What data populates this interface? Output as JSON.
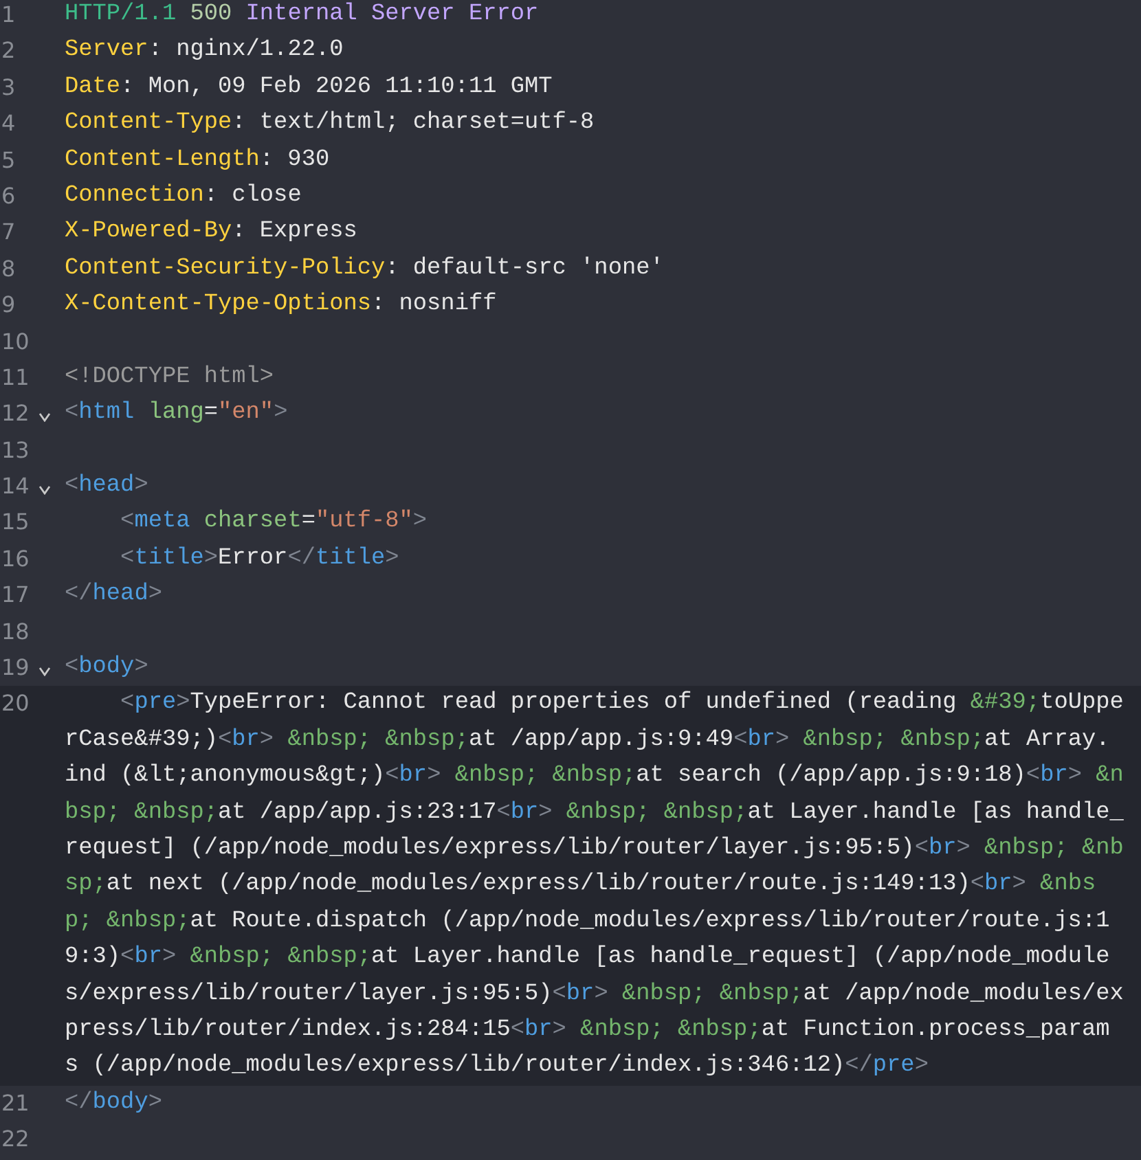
{
  "editor": {
    "lines": [
      {
        "number": "1",
        "rows": [
          {
            "segments": [
              {
                "kind": "proto",
                "text": "HTTP/1.1 "
              },
              {
                "kind": "code",
                "text": "500 "
              },
              {
                "kind": "reason",
                "text": "Internal Server Error"
              }
            ]
          }
        ]
      },
      {
        "number": "2",
        "rows": [
          {
            "segments": [
              {
                "kind": "header",
                "text": "Server"
              },
              {
                "kind": "text",
                "text": ": nginx/1.22.0"
              }
            ]
          }
        ]
      },
      {
        "number": "3",
        "rows": [
          {
            "segments": [
              {
                "kind": "header",
                "text": "Date"
              },
              {
                "kind": "text",
                "text": ": Mon, 09 Feb 2026 11:10:11 GMT"
              }
            ]
          }
        ]
      },
      {
        "number": "4",
        "rows": [
          {
            "segments": [
              {
                "kind": "header",
                "text": "Content-Type"
              },
              {
                "kind": "text",
                "text": ": text/html; charset=utf-8"
              }
            ]
          }
        ]
      },
      {
        "number": "5",
        "rows": [
          {
            "segments": [
              {
                "kind": "header",
                "text": "Content-Length"
              },
              {
                "kind": "text",
                "text": ": 930"
              }
            ]
          }
        ]
      },
      {
        "number": "6",
        "rows": [
          {
            "segments": [
              {
                "kind": "header",
                "text": "Connection"
              },
              {
                "kind": "text",
                "text": ": close"
              }
            ]
          }
        ]
      },
      {
        "number": "7",
        "rows": [
          {
            "segments": [
              {
                "kind": "header",
                "text": "X-Powered-By"
              },
              {
                "kind": "text",
                "text": ": Express"
              }
            ]
          }
        ]
      },
      {
        "number": "8",
        "rows": [
          {
            "segments": [
              {
                "kind": "header",
                "text": "Content-Security-Policy"
              },
              {
                "kind": "text",
                "text": ": default-src 'none'"
              }
            ]
          }
        ]
      },
      {
        "number": "9",
        "rows": [
          {
            "segments": [
              {
                "kind": "header",
                "text": "X-Content-Type-Options"
              },
              {
                "kind": "text",
                "text": ": nosniff"
              }
            ]
          }
        ]
      },
      {
        "number": "10"
      },
      {
        "number": "11",
        "rows": [
          {
            "segments": [
              {
                "kind": "doctype",
                "text": "<!DOCTYPE html>"
              }
            ]
          }
        ]
      },
      {
        "number": "12",
        "fold": true,
        "rows": [
          {
            "segments": [
              {
                "kind": "punct",
                "text": "<"
              },
              {
                "kind": "tag",
                "text": "html "
              },
              {
                "kind": "attr",
                "text": "lang"
              },
              {
                "kind": "text",
                "text": "="
              },
              {
                "kind": "string",
                "text": "\"en\""
              },
              {
                "kind": "punct",
                "text": ">"
              }
            ]
          }
        ]
      },
      {
        "number": "13"
      },
      {
        "number": "14",
        "fold": true,
        "rows": [
          {
            "segments": [
              {
                "kind": "punct",
                "text": "<"
              },
              {
                "kind": "tag",
                "text": "head"
              },
              {
                "kind": "punct",
                "text": ">"
              }
            ]
          }
        ]
      },
      {
        "number": "15",
        "rows": [
          {
            "segments": [
              {
                "kind": "punct",
                "text": "    <"
              },
              {
                "kind": "tag",
                "text": "meta "
              },
              {
                "kind": "attr",
                "text": "charset"
              },
              {
                "kind": "text",
                "text": "="
              },
              {
                "kind": "string",
                "text": "\"utf-8\""
              },
              {
                "kind": "punct",
                "text": ">"
              }
            ]
          }
        ]
      },
      {
        "number": "16",
        "rows": [
          {
            "segments": [
              {
                "kind": "punct",
                "text": "    <"
              },
              {
                "kind": "tag",
                "text": "title"
              },
              {
                "kind": "punct",
                "text": ">"
              },
              {
                "kind": "text",
                "text": "Error"
              },
              {
                "kind": "punct",
                "text": "</"
              },
              {
                "kind": "tag",
                "text": "title"
              },
              {
                "kind": "punct",
                "text": ">"
              }
            ]
          }
        ]
      },
      {
        "number": "17",
        "rows": [
          {
            "segments": [
              {
                "kind": "punct",
                "text": "</"
              },
              {
                "kind": "tag",
                "text": "head"
              },
              {
                "kind": "punct",
                "text": ">"
              }
            ]
          }
        ]
      },
      {
        "number": "18"
      },
      {
        "number": "19",
        "fold": true,
        "rows": [
          {
            "segments": [
              {
                "kind": "punct",
                "text": "<"
              },
              {
                "kind": "tag",
                "text": "body"
              },
              {
                "kind": "punct",
                "text": ">"
              }
            ]
          }
        ]
      },
      {
        "number": "20",
        "active": true,
        "rows": [
          {
            "segments": [
              {
                "kind": "punct",
                "text": "    <"
              },
              {
                "kind": "tag",
                "text": "pre"
              },
              {
                "kind": "punct",
                "text": ">"
              },
              {
                "kind": "text",
                "text": "TypeError: Cannot read properties of undefined (reading "
              },
              {
                "kind": "entity",
                "text": "&#39;"
              },
              {
                "kind": "text",
                "text": "toUppe"
              }
            ]
          },
          {
            "segments": [
              {
                "kind": "text",
                "text": "rCase&#39;)"
              },
              {
                "kind": "punct",
                "text": "<"
              },
              {
                "kind": "tag",
                "text": "br"
              },
              {
                "kind": "punct",
                "text": ">"
              },
              {
                "kind": "entity",
                "text": " &nbsp; &nbsp;"
              },
              {
                "kind": "text",
                "text": "at /app/app.js:9:49"
              },
              {
                "kind": "punct",
                "text": "<"
              },
              {
                "kind": "tag",
                "text": "br"
              },
              {
                "kind": "punct",
                "text": ">"
              },
              {
                "kind": "entity",
                "text": " &nbsp; &nbsp;"
              },
              {
                "kind": "text",
                "text": "at Array."
              }
            ]
          },
          {
            "segments": [
              {
                "kind": "text",
                "text": "ind (&lt;anonymous&gt;)"
              },
              {
                "kind": "punct",
                "text": "<"
              },
              {
                "kind": "tag",
                "text": "br"
              },
              {
                "kind": "punct",
                "text": ">"
              },
              {
                "kind": "entity",
                "text": " &nbsp; &nbsp;"
              },
              {
                "kind": "text",
                "text": "at search (/app/app.js:9:18)"
              },
              {
                "kind": "punct",
                "text": "<"
              },
              {
                "kind": "tag",
                "text": "br"
              },
              {
                "kind": "punct",
                "text": ">"
              },
              {
                "kind": "entity",
                "text": " &n"
              }
            ]
          },
          {
            "segments": [
              {
                "kind": "entity",
                "text": "bsp; &nbsp;"
              },
              {
                "kind": "text",
                "text": "at /app/app.js:23:17"
              },
              {
                "kind": "punct",
                "text": "<"
              },
              {
                "kind": "tag",
                "text": "br"
              },
              {
                "kind": "punct",
                "text": ">"
              },
              {
                "kind": "entity",
                "text": " &nbsp; &nbsp;"
              },
              {
                "kind": "text",
                "text": "at Layer.handle [as handle_"
              }
            ]
          },
          {
            "segments": [
              {
                "kind": "text",
                "text": "request] (/app/node_modules/express/lib/router/layer.js:95:5)"
              },
              {
                "kind": "punct",
                "text": "<"
              },
              {
                "kind": "tag",
                "text": "br"
              },
              {
                "kind": "punct",
                "text": ">"
              },
              {
                "kind": "entity",
                "text": " &nbsp; &nb"
              }
            ]
          },
          {
            "segments": [
              {
                "kind": "entity",
                "text": "sp;"
              },
              {
                "kind": "text",
                "text": "at next (/app/node_modules/express/lib/router/route.js:149:13)"
              },
              {
                "kind": "punct",
                "text": "<"
              },
              {
                "kind": "tag",
                "text": "br"
              },
              {
                "kind": "punct",
                "text": ">"
              },
              {
                "kind": "entity",
                "text": " &nbs"
              }
            ]
          },
          {
            "segments": [
              {
                "kind": "entity",
                "text": "p; &nbsp;"
              },
              {
                "kind": "text",
                "text": "at Route.dispatch (/app/node_modules/express/lib/router/route.js:1"
              }
            ]
          },
          {
            "segments": [
              {
                "kind": "text",
                "text": "9:3)"
              },
              {
                "kind": "punct",
                "text": "<"
              },
              {
                "kind": "tag",
                "text": "br"
              },
              {
                "kind": "punct",
                "text": ">"
              },
              {
                "kind": "entity",
                "text": " &nbsp; &nbsp;"
              },
              {
                "kind": "text",
                "text": "at Layer.handle [as handle_request] (/app/node_module"
              }
            ]
          },
          {
            "segments": [
              {
                "kind": "text",
                "text": "s/express/lib/router/layer.js:95:5)"
              },
              {
                "kind": "punct",
                "text": "<"
              },
              {
                "kind": "tag",
                "text": "br"
              },
              {
                "kind": "punct",
                "text": ">"
              },
              {
                "kind": "entity",
                "text": " &nbsp; &nbsp;"
              },
              {
                "kind": "text",
                "text": "at /app/node_modules/ex"
              }
            ]
          },
          {
            "segments": [
              {
                "kind": "text",
                "text": "press/lib/router/index.js:284:15"
              },
              {
                "kind": "punct",
                "text": "<"
              },
              {
                "kind": "tag",
                "text": "br"
              },
              {
                "kind": "punct",
                "text": ">"
              },
              {
                "kind": "entity",
                "text": " &nbsp; &nbsp;"
              },
              {
                "kind": "text",
                "text": "at Function.process_param"
              }
            ]
          },
          {
            "segments": [
              {
                "kind": "text",
                "text": "s (/app/node_modules/express/lib/router/index.js:346:12)"
              },
              {
                "kind": "punct",
                "text": "</"
              },
              {
                "kind": "tag",
                "text": "pre"
              },
              {
                "kind": "punct",
                "text": ">"
              }
            ]
          }
        ]
      },
      {
        "number": "21",
        "rows": [
          {
            "segments": [
              {
                "kind": "punct",
                "text": "</"
              },
              {
                "kind": "tag",
                "text": "body"
              },
              {
                "kind": "punct",
                "text": ">"
              }
            ]
          }
        ]
      },
      {
        "number": "22"
      }
    ]
  }
}
